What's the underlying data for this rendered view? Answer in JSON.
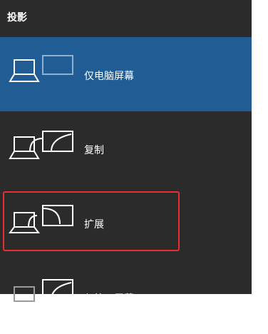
{
  "panel": {
    "title": "投影",
    "items": [
      {
        "label": "仅电脑屏幕",
        "selected": true,
        "icon": "pc-screen-only-icon"
      },
      {
        "label": "复制",
        "selected": false,
        "icon": "duplicate-icon"
      },
      {
        "label": "扩展",
        "selected": false,
        "icon": "extend-icon"
      },
      {
        "label": "仅第二屏幕",
        "selected": false,
        "icon": "second-screen-only-icon"
      }
    ]
  },
  "colors": {
    "panel_bg": "#2b2b2b",
    "selected_bg": "#1f5d94",
    "annotation_border": "#e5302f"
  }
}
